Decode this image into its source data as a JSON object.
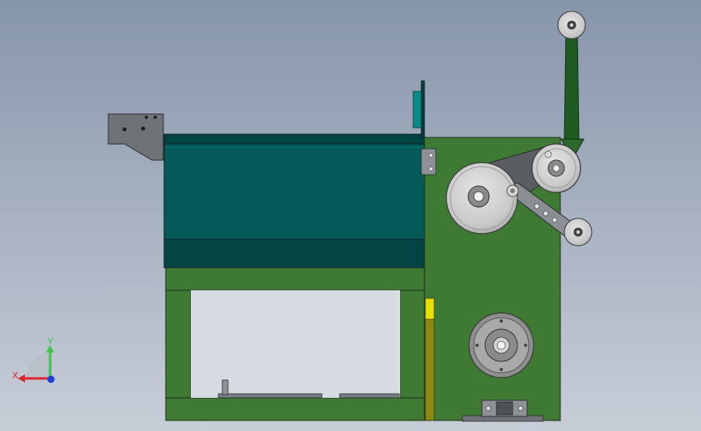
{
  "colors": {
    "background_top": "#8795ab",
    "background_bottom": "#c8ced8",
    "frame_green": "#3f7a35",
    "frame_green_dark": "#2f5f28",
    "hopper_teal": "#035a58",
    "hopper_teal_dark": "#024544",
    "plate_gray": "#6f7377",
    "wheel_gray": "#c9c9c9",
    "wheel_dark": "#7b7b7b",
    "accent_yellow": "#e7e000",
    "post_green": "#1f5c22",
    "axis_x": "#e0252a",
    "axis_y": "#3dc24a",
    "axis_z": "#1f3fd6"
  },
  "triad": {
    "x_label": "X",
    "y_label": "Y"
  },
  "icons": {
    "triad": "coordinate-axes-icon"
  }
}
